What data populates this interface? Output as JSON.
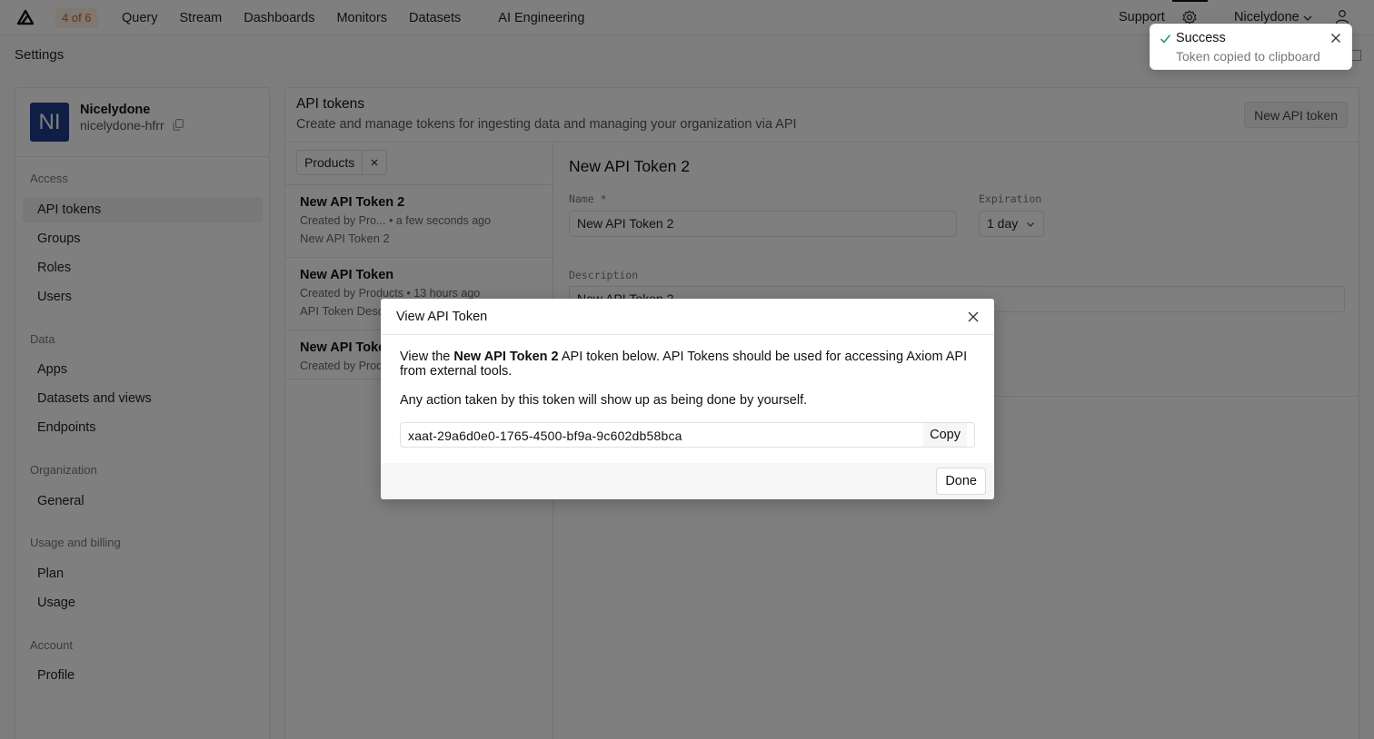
{
  "topnav": {
    "badge": "4 of 6",
    "links": [
      "Query",
      "Stream",
      "Dashboards",
      "Monitors",
      "Datasets",
      "AI Engineering"
    ],
    "support": "Support",
    "org": "Nicelydone"
  },
  "page": {
    "title": "Settings"
  },
  "org_card": {
    "avatar": "NI",
    "name": "Nicelydone",
    "slug": "nicelydone-hfrr"
  },
  "sidebar": {
    "access_title": "Access",
    "access_items": [
      "API tokens",
      "Groups",
      "Roles",
      "Users"
    ],
    "data_title": "Data",
    "data_items": [
      "Apps",
      "Datasets and views",
      "Endpoints"
    ],
    "org_title": "Organization",
    "org_items": [
      "General"
    ],
    "billing_title": "Usage and billing",
    "billing_items": [
      "Plan",
      "Usage"
    ],
    "account_title": "Account",
    "account_items": [
      "Profile"
    ]
  },
  "main": {
    "title": "API tokens",
    "subtitle": "Create and manage tokens for ingesting data and managing your organization via API",
    "new_button": "New API token",
    "filter_chip": "Products",
    "tokens": [
      {
        "name": "New API Token 2",
        "meta": "Created by Pro...  • a few seconds ago",
        "desc": "New API Token 2"
      },
      {
        "name": "New API Token",
        "meta": "Created by Products • 13 hours ago",
        "desc": "API Token Desc"
      },
      {
        "name": "New API Token",
        "meta": "Created by Produ",
        "desc": ""
      }
    ]
  },
  "detail": {
    "title": "New API Token 2",
    "name_label": "Name *",
    "name_value": "New API Token 2",
    "expiration_label": "Expiration",
    "expiration_value": "1 day",
    "description_label": "Description",
    "description_value": "New API Token 2"
  },
  "modal": {
    "title": "View API Token",
    "p1_pre": "View the ",
    "p1_bold": "New API Token 2",
    "p1_post": " API token below. API Tokens should be used for accessing Axiom API from external tools.",
    "p2": "Any action taken by this token will show up as being done by yourself.",
    "token": "xaat-29a6d0e0-1765-4500-bf9a-9c602db58bca",
    "copy": "Copy",
    "done": "Done"
  },
  "toast": {
    "title": "Success",
    "message": "Token copied to clipboard"
  },
  "colors": {
    "badge_bg": "#fdf1e3",
    "badge_text": "#e25c1e",
    "avatar": "#1f3d8a",
    "success": "#2e9d5b"
  }
}
